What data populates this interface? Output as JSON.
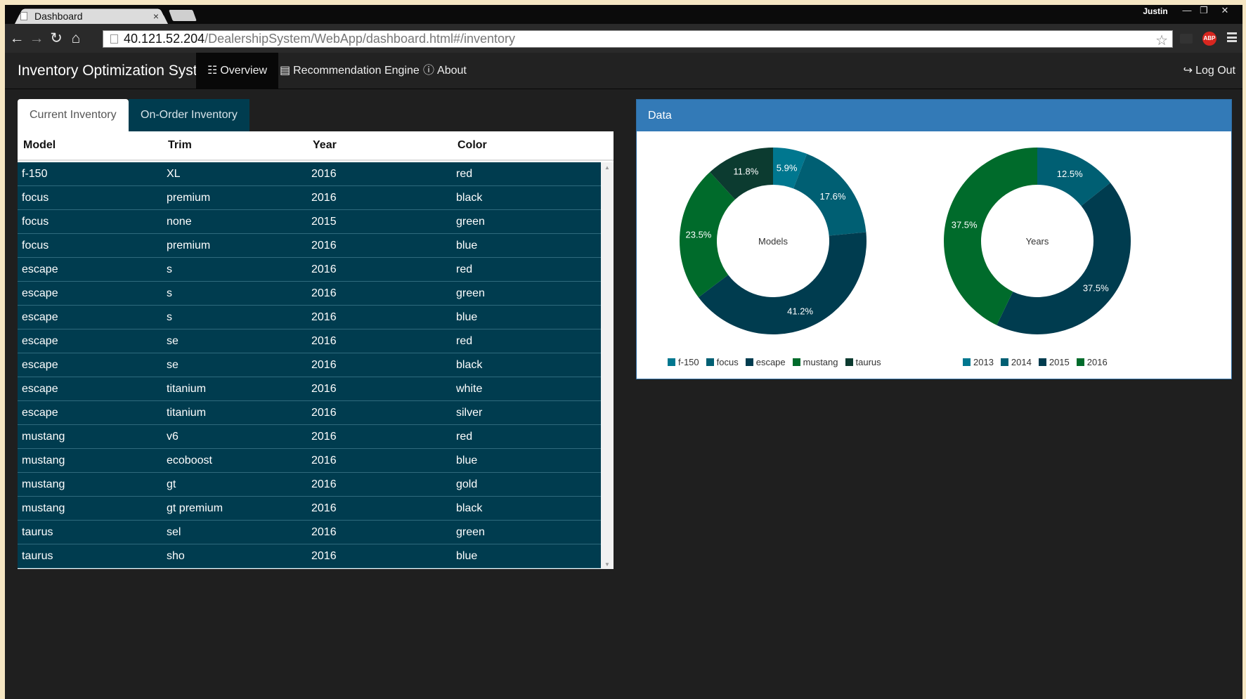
{
  "browser": {
    "tab_title": "Dashboard",
    "tab_close": "×",
    "user": "Justin",
    "window_buttons": [
      "—",
      "❐",
      "✕"
    ],
    "url_host": "40.121.52.204",
    "url_path": "/DealershipSystem/WebApp/dashboard.html#/inventory",
    "abp": "ABP"
  },
  "navbar": {
    "brand": "Inventory Optimization System:",
    "overview": "Overview",
    "recommendation": "Recommendation Engine",
    "about": "About",
    "logout": "Log Out"
  },
  "tabs": {
    "current": "Current Inventory",
    "on_order": "On-Order Inventory"
  },
  "table": {
    "headers": [
      "Model",
      "Trim",
      "Year",
      "Color"
    ],
    "rows": [
      [
        "f-150",
        "XL",
        "2016",
        "red"
      ],
      [
        "focus",
        "premium",
        "2016",
        "black"
      ],
      [
        "focus",
        "none",
        "2015",
        "green"
      ],
      [
        "focus",
        "premium",
        "2016",
        "blue"
      ],
      [
        "escape",
        "s",
        "2016",
        "red"
      ],
      [
        "escape",
        "s",
        "2016",
        "green"
      ],
      [
        "escape",
        "s",
        "2016",
        "blue"
      ],
      [
        "escape",
        "se",
        "2016",
        "red"
      ],
      [
        "escape",
        "se",
        "2016",
        "black"
      ],
      [
        "escape",
        "titanium",
        "2016",
        "white"
      ],
      [
        "escape",
        "titanium",
        "2016",
        "silver"
      ],
      [
        "mustang",
        "v6",
        "2016",
        "red"
      ],
      [
        "mustang",
        "ecoboost",
        "2016",
        "blue"
      ],
      [
        "mustang",
        "gt",
        "2016",
        "gold"
      ],
      [
        "mustang",
        "gt premium",
        "2016",
        "black"
      ],
      [
        "taurus",
        "sel",
        "2016",
        "green"
      ],
      [
        "taurus",
        "sho",
        "2016",
        "blue"
      ]
    ]
  },
  "data_panel": {
    "heading": "Data"
  },
  "colors": {
    "row_bg": "#003c4f",
    "panel_heading": "#337ab7"
  },
  "chart_data": [
    {
      "type": "pie",
      "title": "Models",
      "categories": [
        "f-150",
        "focus",
        "escape",
        "mustang",
        "taurus"
      ],
      "values": [
        5.9,
        17.6,
        41.2,
        23.5,
        11.8
      ],
      "labels": [
        "5.9%",
        "17.6%",
        "41.2%",
        "23.5%",
        "11.8%"
      ],
      "colors": [
        "#00778f",
        "#005f73",
        "#003c4f",
        "#006b2b",
        "#0c3b30"
      ],
      "legend": "bottom"
    },
    {
      "type": "pie",
      "title": "Years",
      "categories": [
        "2013",
        "2014",
        "2015",
        "2016"
      ],
      "values": [
        0,
        12.5,
        37.5,
        37.5
      ],
      "labels": [
        "",
        "12.5%",
        "37.5%",
        "37.5%"
      ],
      "colors": [
        "#00778f",
        "#005f73",
        "#003c4f",
        "#006b2b"
      ],
      "legend": "bottom"
    }
  ]
}
